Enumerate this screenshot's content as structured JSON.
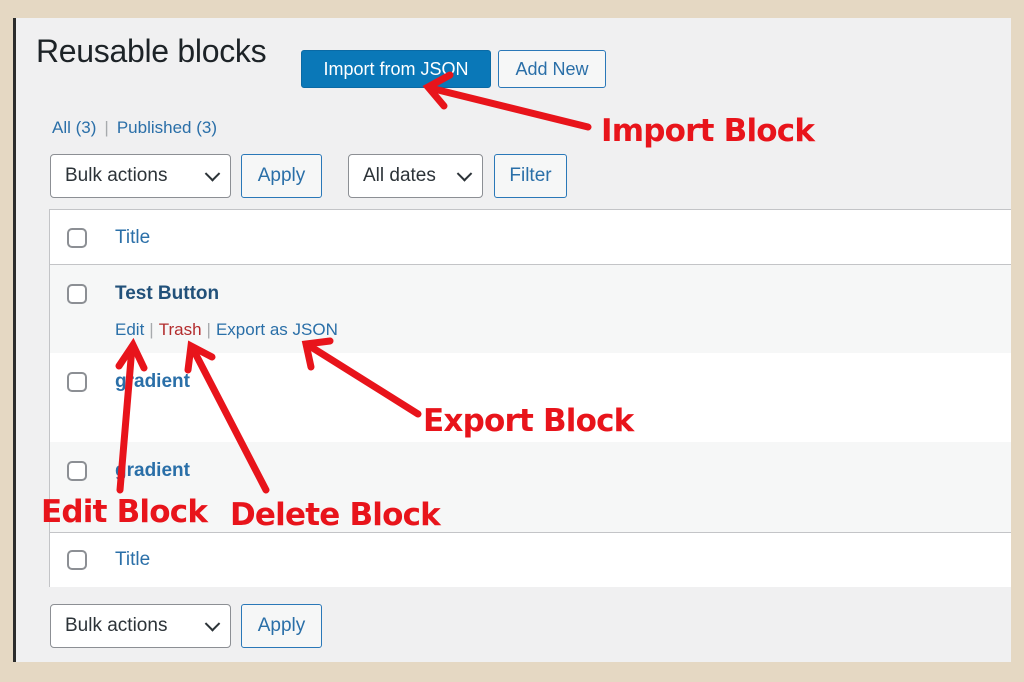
{
  "page": {
    "title": "Reusable blocks",
    "import_button": "Import from JSON",
    "add_new_button": "Add New"
  },
  "views": {
    "all": "All (3)",
    "separator": "|",
    "published": "Published (3)"
  },
  "top_actions": {
    "bulk_actions": "Bulk actions",
    "apply": "Apply",
    "dates": "All dates",
    "filter": "Filter"
  },
  "table": {
    "header_title": "Title",
    "footer_title": "Title",
    "rows": [
      {
        "title": "Test Button",
        "actions": {
          "edit": "Edit",
          "trash": "Trash",
          "export": "Export as JSON",
          "separator": "|"
        }
      },
      {
        "title": "gradient"
      },
      {
        "title": "gradient"
      }
    ]
  },
  "bottom_actions": {
    "bulk_actions": "Bulk actions",
    "apply": "Apply"
  },
  "annotations": {
    "import": "Import Block",
    "export": "Export Block",
    "edit": "Edit Block",
    "delete": "Delete Block",
    "color": "#e8141b"
  },
  "colors": {
    "primary": "#0a78b8",
    "link": "#2a6fa8",
    "trash": "#b32d2e",
    "frame": "#e5d8c3"
  }
}
